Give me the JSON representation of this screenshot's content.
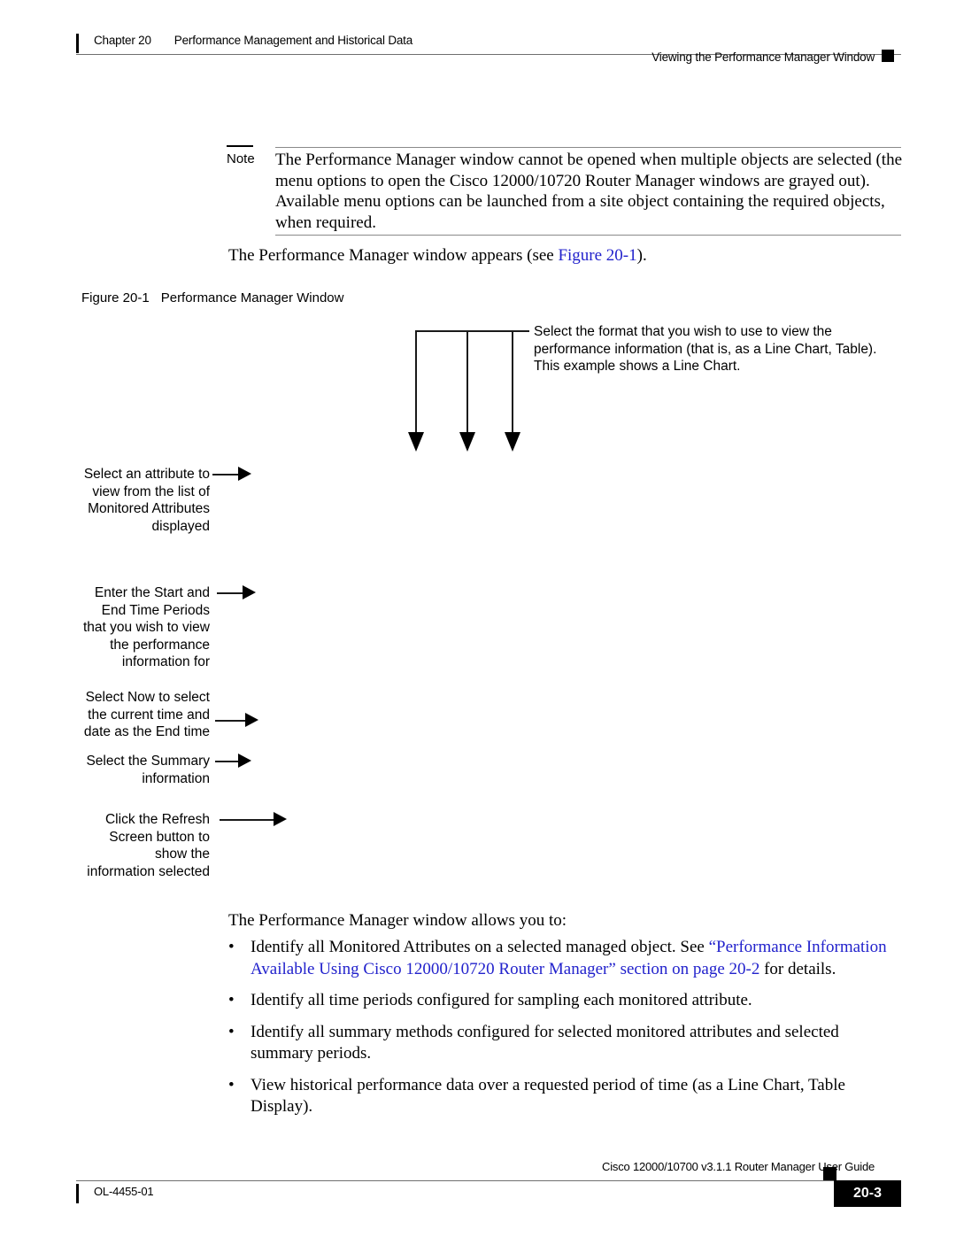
{
  "header": {
    "chapter_number": "Chapter 20",
    "chapter_title": "Performance Management and Historical Data",
    "section_title": "Viewing the Performance Manager Window"
  },
  "note": {
    "label": "Note",
    "body": "The Performance Manager window cannot be opened when multiple objects are selected (the menu options to open the Cisco 12000/10720 Router Manager windows are grayed out). Available menu options can be launched from a site object containing the required objects, when required."
  },
  "intro": {
    "text_before": "The Performance Manager window appears (see ",
    "link_text": "Figure 20-1",
    "text_after": ")."
  },
  "figure": {
    "number": "Figure 20-1",
    "title": "Performance Manager Window",
    "callouts": {
      "format": "Select the format that you wish to use to view the\nperformance information (that is, as a Line Chart, Table).\nThis example shows a Line Chart.",
      "attribute": "Select an attribute to\nview from the list of\nMonitored Attributes\ndisplayed",
      "time_periods": "Enter the Start and\nEnd Time Periods\nthat you wish to view\nthe performance\ninformation for",
      "now": "Select Now to select\nthe current time and\ndate as the End time",
      "summary": "Select the Summary\ninformation",
      "refresh": "Click the Refresh\nScreen button to\nshow the\ninformation selected"
    }
  },
  "body": {
    "intro": "The Performance Manager window allows you to:",
    "bullet_marker": "•",
    "bullets": [
      {
        "segments": [
          {
            "text": "Identify all Monitored Attributes on a selected managed object. See ",
            "link": false
          },
          {
            "text": "“Performance Information Available Using Cisco 12000/10720 Router Manager” section on page 20-2",
            "link": true
          },
          {
            "text": " for details.",
            "link": false
          }
        ]
      },
      {
        "segments": [
          {
            "text": "Identify all time periods configured for sampling each monitored attribute.",
            "link": false
          }
        ]
      },
      {
        "segments": [
          {
            "text": "Identify all summary methods configured for selected monitored attributes and selected summary periods.",
            "link": false
          }
        ]
      },
      {
        "segments": [
          {
            "text": "View historical performance data over a requested period of time (as a Line Chart, Table Display).",
            "link": false
          }
        ]
      }
    ]
  },
  "footer": {
    "guide_title": "Cisco 12000/10700 v3.1.1 Router Manager User Guide",
    "doc_id": "OL-4455-01",
    "page_number": "20-3"
  },
  "colors": {
    "link": "#2222cc",
    "rule": "#6f6f6f",
    "ink": "#000000"
  }
}
